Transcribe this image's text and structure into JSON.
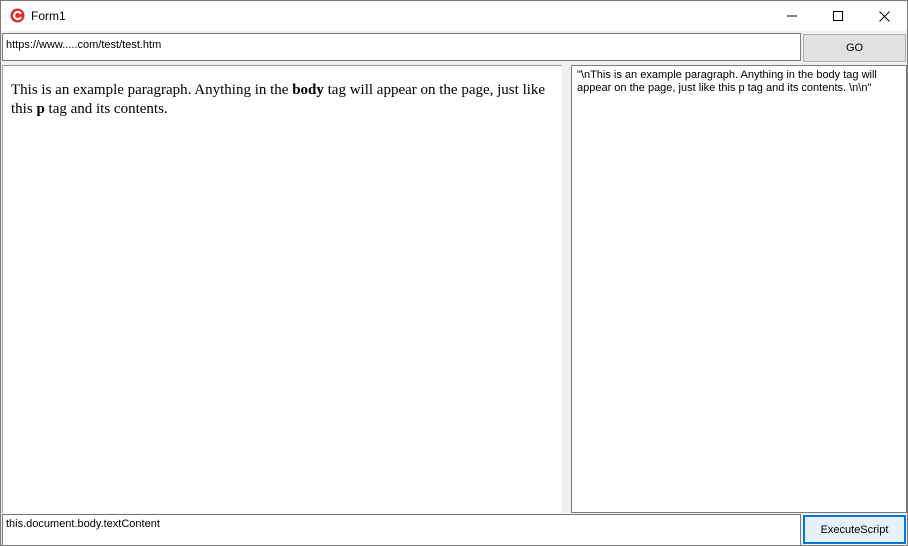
{
  "window": {
    "title": "Form1",
    "brand_color": "#e02b2b"
  },
  "url_bar": {
    "value": "https://www.....com/test/test.htm",
    "go_label": "GO"
  },
  "browser": {
    "paragraph": {
      "part1": "This is an example paragraph. Anything in the ",
      "bold1": "body",
      "part2": " tag will appear on the page, just like this ",
      "bold2": "p",
      "part3": " tag and its contents."
    }
  },
  "output": {
    "text": "\"\\nThis is an example paragraph. Anything in the body tag will appear on the page, just like this p tag and its contents. \\n\\n\""
  },
  "script_bar": {
    "value": "this.document.body.textContent",
    "execute_label": "ExecuteScript"
  }
}
